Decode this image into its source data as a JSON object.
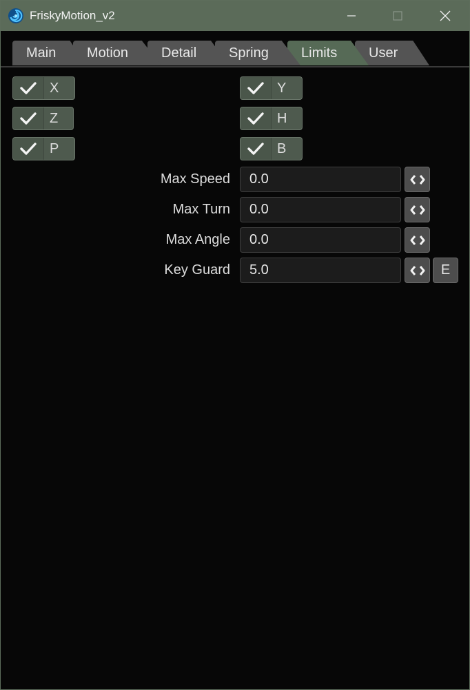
{
  "window": {
    "title": "FriskyMotion_v2"
  },
  "tabs": [
    {
      "label": "Main",
      "active": false
    },
    {
      "label": "Motion",
      "active": false
    },
    {
      "label": "Detail",
      "active": false
    },
    {
      "label": "Spring",
      "active": false
    },
    {
      "label": "Limits",
      "active": true
    },
    {
      "label": "User",
      "active": false
    }
  ],
  "axes": [
    {
      "label": "X",
      "checked": true
    },
    {
      "label": "Y",
      "checked": true
    },
    {
      "label": "Z",
      "checked": true
    },
    {
      "label": "H",
      "checked": true
    },
    {
      "label": "P",
      "checked": true
    },
    {
      "label": "B",
      "checked": true
    }
  ],
  "fields": [
    {
      "label": "Max Speed",
      "value": "0.0"
    },
    {
      "label": "Max Turn",
      "value": "0.0"
    },
    {
      "label": "Max Angle",
      "value": "0.0"
    },
    {
      "label": "Key Guard",
      "value": "5.0"
    }
  ],
  "envelope_button_label": "E",
  "icons": {
    "app": "spiral-app-icon",
    "check": "checkmark-icon",
    "envelope": "diamond-arrows-icon"
  },
  "colors": {
    "titlebar": "#5b6b59",
    "active_tab": "#566a56",
    "background": "#070707"
  }
}
